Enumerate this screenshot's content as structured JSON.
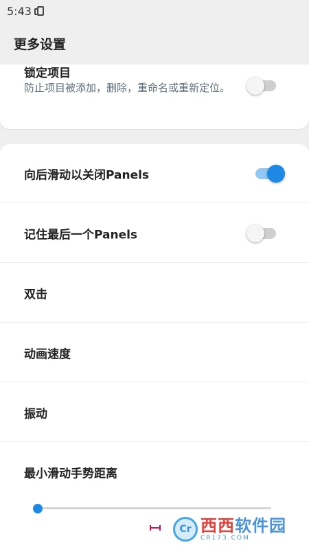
{
  "status_bar": {
    "time": "5:43"
  },
  "app_bar": {
    "title": "更多设置"
  },
  "lock_items": {
    "title": "锁定项目",
    "description": "防止项目被添加，删除，重命名或重新定位。",
    "enabled": false
  },
  "settings": [
    {
      "label": "向后滑动以关闭Panels",
      "toggle": true,
      "enabled": true
    },
    {
      "label": "记住最后一个Panels",
      "toggle": true,
      "enabled": false
    },
    {
      "label": "双击",
      "toggle": false
    },
    {
      "label": "动画速度",
      "toggle": false
    },
    {
      "label": "振动",
      "toggle": false
    },
    {
      "label": "最小滑动手势距离",
      "toggle": false
    }
  ],
  "slider": {
    "value_fraction": 0.0
  },
  "watermark": {
    "brand_a": "西西",
    "brand_b": "软件园",
    "url": "CR173.COM"
  },
  "colors": {
    "accent": "#1e88e5",
    "background": "#efefef",
    "description": "#5f6f79"
  }
}
